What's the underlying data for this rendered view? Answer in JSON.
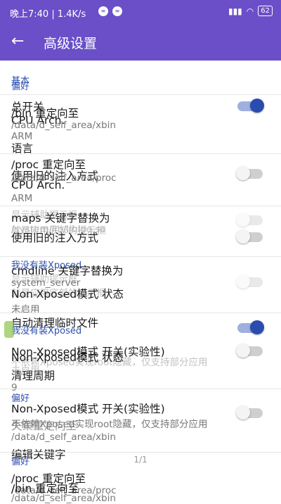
{
  "status_bar": {
    "time": "晚上7:40",
    "speed": "1.4K/s",
    "battery": "62"
  },
  "app_bar": {
    "title": "高级设置"
  },
  "rows": [
    {
      "text": "基本"
    },
    {
      "text": "偏好"
    },
    {
      "text": "总开关"
    },
    {
      "text": "/bin 重定向至"
    },
    {
      "text": "CPU Arch."
    },
    {
      "text": "/data/d_self_area/xbin"
    },
    {
      "text": "ARM"
    },
    {
      "text": "语言"
    },
    {
      "text": "/proc 重定向至"
    },
    {
      "text": "使用旧的注入方式"
    },
    {
      "text": "/data/d_self_area/proc"
    },
    {
      "text": "CPU Arch."
    },
    {
      "text": "ARM"
    },
    {
      "text": "显示辅助提示框"
    },
    {
      "text": "maps 关键字替换为"
    },
    {
      "text": "就是应用底部的提示框"
    },
    {
      "text": "/system/lib/libloq.so"
    },
    {
      "text": "使用旧的注入方式"
    },
    {
      "text": "我没有装Xposed"
    },
    {
      "text": "cmdline 关键字替换为"
    },
    {
      "text": "显示辅助提示框"
    },
    {
      "text": "system_server"
    },
    {
      "text": "Non-Xposed模式 状态"
    },
    {
      "text": "就是应用底部的提示框"
    },
    {
      "text": "未启用"
    },
    {
      "text": "自动清理临时文件"
    },
    {
      "text": "我没有装Xposed"
    },
    {
      "text": "Non-Xposed模式 开关(实验性)"
    },
    {
      "text": "Non-Xposed模式 状态"
    },
    {
      "text": "不依赖Xposed实现root隐藏，仅支持部分应用"
    },
    {
      "text": "未启用"
    },
    {
      "text": "清理周期"
    },
    {
      "text": "9"
    },
    {
      "text": "偏好"
    },
    {
      "text": "Non-Xposed模式 开关(实验性)"
    },
    {
      "text": "不依赖Xposed实现root隐藏，仅支持部分应用"
    },
    {
      "text": "失策重定向至"
    },
    {
      "text": "/data/d_self_area/xbin"
    },
    {
      "text": "编辑关键字"
    },
    {
      "text": "偏好"
    },
    {
      "text": "/proc 重定向至"
    },
    {
      "text": "/data/d_self_area/proc"
    },
    {
      "text": "/bin 重定向至"
    },
    {
      "text": "/data/d_self_area/xbin"
    }
  ],
  "toggles": [
    {
      "state": "on"
    },
    {
      "state": "off"
    },
    {
      "state": "off"
    },
    {
      "state": "off"
    },
    {
      "state": "off"
    },
    {
      "state": "on"
    },
    {
      "state": "off"
    },
    {
      "state": "off"
    }
  ],
  "footer": {
    "page": "1/1"
  }
}
